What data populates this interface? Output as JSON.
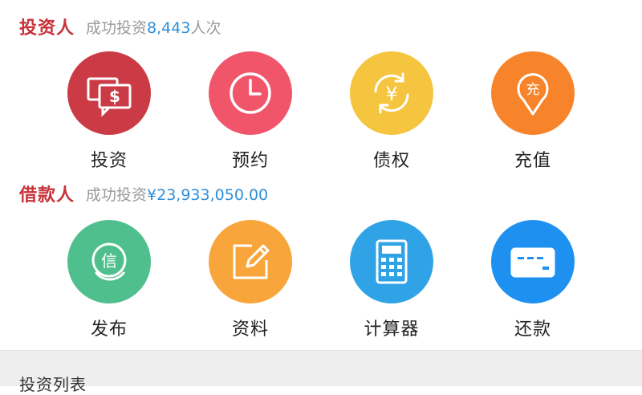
{
  "investor": {
    "title": "投资人",
    "stat_prefix": "成功投资",
    "stat_value": "8,443",
    "stat_suffix": "人次",
    "tiles": [
      {
        "label": "投资",
        "icon": "invest-money-icon",
        "color": "#cb3b45"
      },
      {
        "label": "预约",
        "icon": "clock-icon",
        "color": "#f0556a"
      },
      {
        "label": "债权",
        "icon": "yen-exchange-icon",
        "color": "#f6c540"
      },
      {
        "label": "充值",
        "icon": "recharge-pin-icon",
        "color": "#f7842b"
      }
    ]
  },
  "borrower": {
    "title": "借款人",
    "stat_prefix": "成功投资",
    "stat_value": "¥23,933,050.00",
    "tiles": [
      {
        "label": "发布",
        "icon": "credit-coin-icon",
        "color": "#4fc08d"
      },
      {
        "label": "资料",
        "icon": "edit-document-icon",
        "color": "#f8a63b"
      },
      {
        "label": "计算器",
        "icon": "calculator-icon",
        "color": "#2fa3e6"
      },
      {
        "label": "还款",
        "icon": "bank-card-icon",
        "color": "#1e90f0"
      }
    ]
  },
  "list": {
    "title": "投资列表"
  }
}
